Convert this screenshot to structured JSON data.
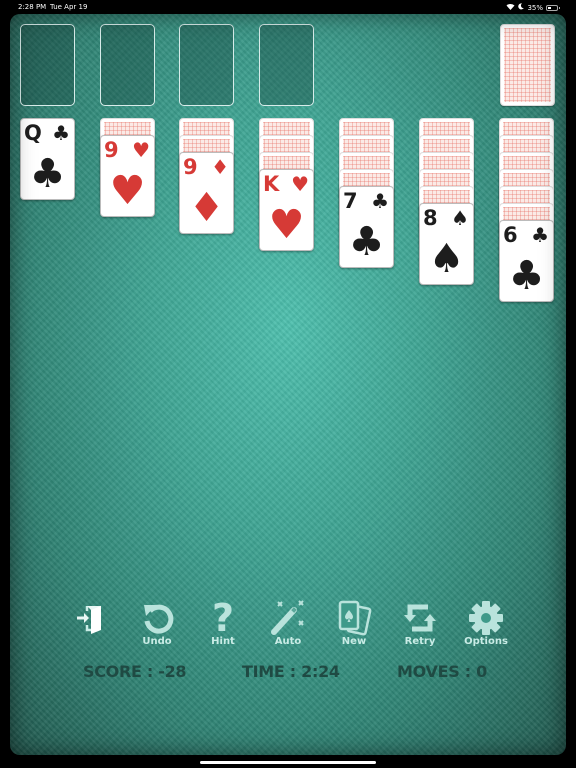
{
  "status_bar": {
    "time": "2:28 PM",
    "date": "Tue Apr 19",
    "battery_text": "35%",
    "battery_level": 0.35,
    "icons": [
      "wifi-icon",
      "moon-icon",
      "battery-icon"
    ]
  },
  "foundations": [
    {
      "state": "empty"
    },
    {
      "state": "empty"
    },
    {
      "state": "empty"
    },
    {
      "state": "empty"
    }
  ],
  "stock": {
    "state": "face-down"
  },
  "tableau": [
    {
      "hidden": 0,
      "face": {
        "rank": "Q",
        "suit": "♣",
        "color": "black"
      }
    },
    {
      "hidden": 1,
      "face": {
        "rank": "9",
        "suit": "♥",
        "color": "red"
      }
    },
    {
      "hidden": 2,
      "face": {
        "rank": "9",
        "suit": "♦",
        "color": "red"
      }
    },
    {
      "hidden": 3,
      "face": {
        "rank": "K",
        "suit": "♥",
        "color": "red"
      }
    },
    {
      "hidden": 4,
      "face": {
        "rank": "7",
        "suit": "♣",
        "color": "black"
      }
    },
    {
      "hidden": 5,
      "face": {
        "rank": "8",
        "suit": "♠",
        "color": "black"
      }
    },
    {
      "hidden": 6,
      "face": {
        "rank": "6",
        "suit": "♣",
        "color": "black"
      }
    }
  ],
  "toolbar": {
    "exit_label": "",
    "undo_label": "Undo",
    "hint_label": "Hint",
    "auto_label": "Auto",
    "new_label": "New",
    "retry_label": "Retry",
    "options_label": "Options"
  },
  "stats": {
    "score": "SCORE : -28",
    "time": "TIME : 2:24",
    "moves": "MOVES : 0"
  },
  "colors": {
    "red_suit": "#d63a36",
    "black_suit": "#1d1d1d",
    "felt": "#3fa594",
    "toolbar_icon": "#b9e3dc",
    "stats_text": "#1f4a43"
  }
}
